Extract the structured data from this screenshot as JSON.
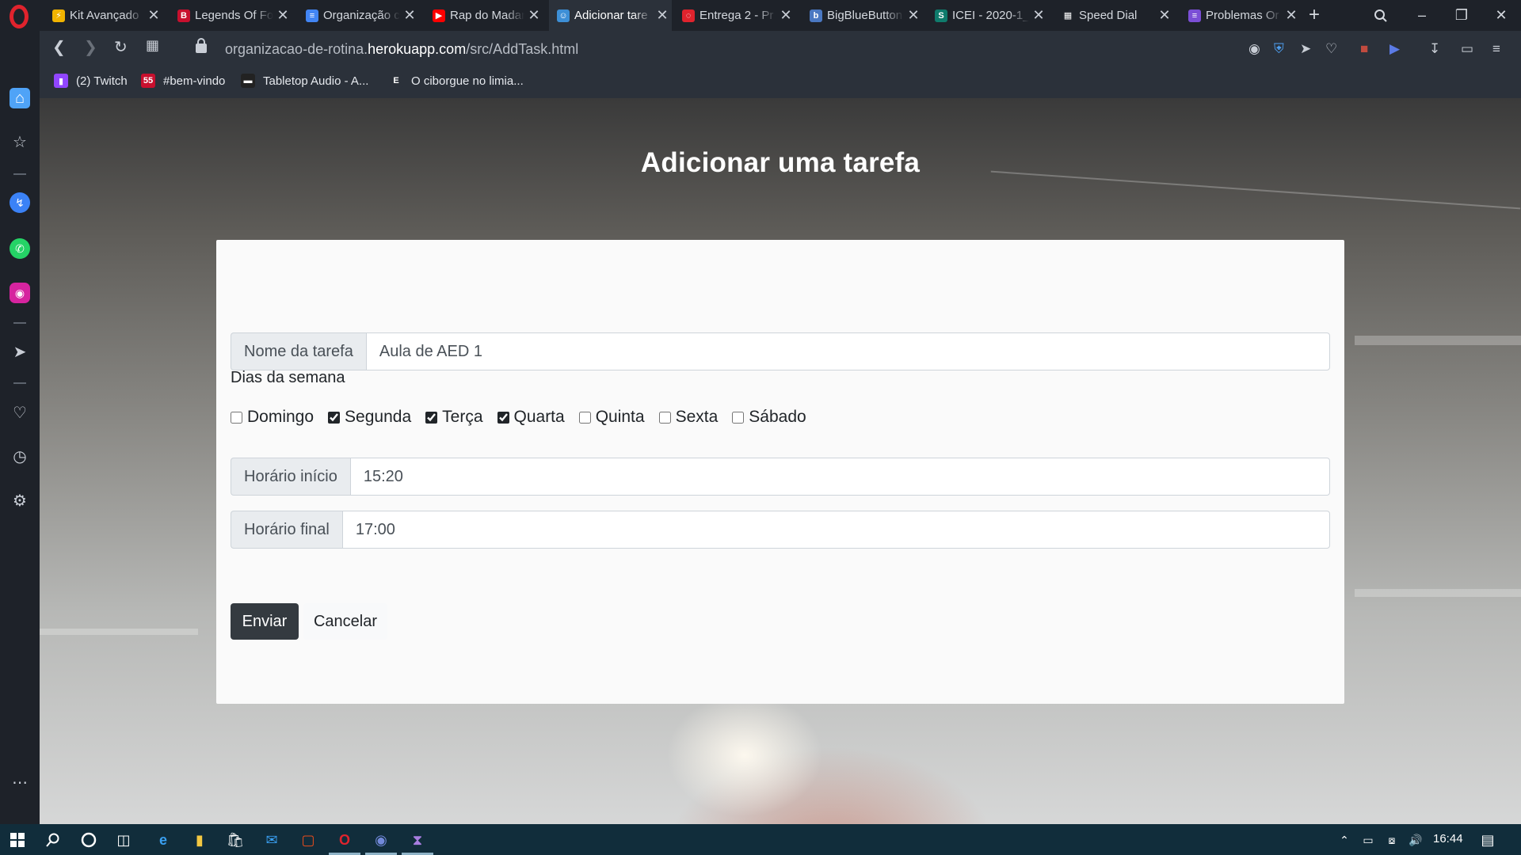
{
  "browser": {
    "tabs": [
      {
        "title": "Kit Avançado",
        "favicon_color": "#f2b400",
        "favicon_glyph": "⚡",
        "active": false
      },
      {
        "title": "Legends Of Fo",
        "favicon_color": "#c8102e",
        "favicon_glyph": "B",
        "active": false
      },
      {
        "title": "Organização c",
        "favicon_color": "#4285f4",
        "favicon_glyph": "≡",
        "active": false
      },
      {
        "title": "Rap do Madar",
        "favicon_color": "#ff0000",
        "favicon_glyph": "▶",
        "active": false
      },
      {
        "title": "Adicionar tare",
        "favicon_color": "#3d8fd6",
        "favicon_glyph": "☺",
        "active": true
      },
      {
        "title": "Entrega 2 - Pr",
        "favicon_color": "#e0232d",
        "favicon_glyph": "◌",
        "active": false
      },
      {
        "title": "BigBlueButton",
        "favicon_color": "#4a78c2",
        "favicon_glyph": "b",
        "active": false
      },
      {
        "title": "ICEI - 2020-1_",
        "favicon_color": "#0f7b6c",
        "favicon_glyph": "S",
        "active": false
      },
      {
        "title": "Speed Dial",
        "favicon_color": "#ffffff",
        "favicon_glyph": "▦",
        "active": false
      },
      {
        "title": "Problemas Or",
        "favicon_color": "#7b4fd6",
        "favicon_glyph": "≡",
        "active": false
      }
    ],
    "url_prefix": "organizacao-de-rotina.",
    "url_domain": "herokuapp.com",
    "url_path": "/src/AddTask.html",
    "bookmarks": [
      {
        "label": "(2) Twitch",
        "color": "#9146ff",
        "glyph": "▮"
      },
      {
        "label": "#bem-vindo",
        "color": "#c8102e",
        "glyph": "55"
      },
      {
        "label": "Tabletop Audio - A...",
        "color": "#222222",
        "glyph": "▬"
      },
      {
        "label": "O ciborgue no limia...",
        "color": "#2b313a",
        "glyph": "E"
      }
    ]
  },
  "page": {
    "title": "Adicionar uma tarefa",
    "task_name": {
      "label": "Nome da tarefa",
      "value": "Aula de AED 1"
    },
    "days_label": "Dias da semana",
    "days": [
      {
        "label": "Domingo",
        "checked": false
      },
      {
        "label": "Segunda",
        "checked": true
      },
      {
        "label": "Terça",
        "checked": true
      },
      {
        "label": "Quarta",
        "checked": true
      },
      {
        "label": "Quinta",
        "checked": false
      },
      {
        "label": "Sexta",
        "checked": false
      },
      {
        "label": "Sábado",
        "checked": false
      }
    ],
    "start_time": {
      "label": "Horário início",
      "value": "15:20"
    },
    "end_time": {
      "label": "Horário final",
      "value": "17:00"
    },
    "submit_label": "Enviar",
    "cancel_label": "Cancelar"
  },
  "taskbar": {
    "time": "16:44"
  }
}
